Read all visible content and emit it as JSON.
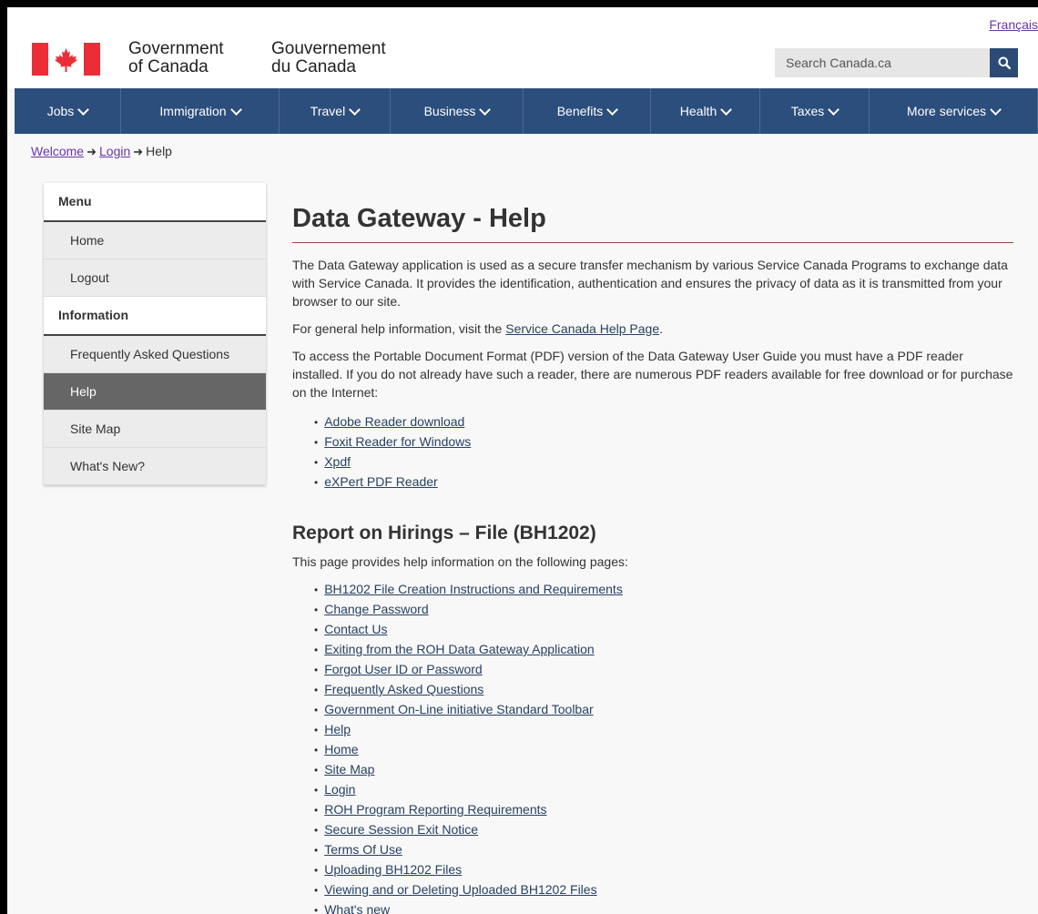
{
  "header": {
    "language_link": "Français",
    "gov_name_en": [
      "Government",
      "of Canada"
    ],
    "gov_name_fr": [
      "Gouvernement",
      "du Canada"
    ],
    "search_placeholder": "Search Canada.ca",
    "search_icon": "search-icon",
    "brand_red": "#eb2d37"
  },
  "nav": {
    "items": [
      {
        "label": "Jobs",
        "width": 117
      },
      {
        "label": "Immigration",
        "width": 174
      },
      {
        "label": "Travel",
        "width": 122
      },
      {
        "label": "Business",
        "width": 146
      },
      {
        "label": "Benefits",
        "width": 140
      },
      {
        "label": "Health",
        "width": 120
      },
      {
        "label": "Taxes",
        "width": 120
      },
      {
        "label": "More services",
        "width": 185
      }
    ],
    "background": "#2c4e7c"
  },
  "breadcrumb": {
    "items": [
      "Welcome",
      "Login"
    ],
    "current": "Help"
  },
  "sidebar": {
    "menu_heading": "Menu",
    "menu_items": [
      "Home",
      "Logout"
    ],
    "info_heading": "Information",
    "info_items": [
      "Frequently Asked Questions",
      "Help",
      "Site Map",
      "What's New?"
    ],
    "active_item": "Help"
  },
  "main": {
    "title": "Data Gateway - Help",
    "intro": "The Data Gateway application is used as a secure transfer mechanism by various Service Canada Programs to exchange data with Service Canada. It provides the identification, authentication and ensures the privacy of data as it is transmitted from your browser to our site.",
    "help_text_before": "For general help information, visit the ",
    "help_link": "Service Canada Help Page",
    "help_text_after": ".",
    "pdf_text": "To access the Portable Document Format (PDF) version of the Data Gateway User Guide you must have a PDF reader installed. If you do not already have such a reader, there are numerous PDF readers available for free download or for purchase on the Internet:",
    "pdf_links": [
      "Adobe Reader download",
      "Foxit Reader for Windows",
      "Xpdf",
      "eXPert PDF Reader"
    ],
    "section_title": "Report on Hirings – File (BH1202)",
    "section_intro": "This page provides help information on the following pages:",
    "section_links": [
      "BH1202 File Creation Instructions and Requirements",
      "Change Password",
      "Contact Us",
      "Exiting from the ROH Data Gateway Application",
      "Forgot User ID or Password",
      "Frequently Asked Questions",
      "Government On-Line initiative Standard Toolbar",
      "Help",
      "Home",
      "Site Map",
      "Login",
      "ROH Program Reporting Requirements",
      "Secure Session Exit Notice",
      "Terms Of Use",
      "Uploading BH1202 Files",
      "Viewing and or Deleting Uploaded BH1202 Files",
      "What's new"
    ]
  }
}
